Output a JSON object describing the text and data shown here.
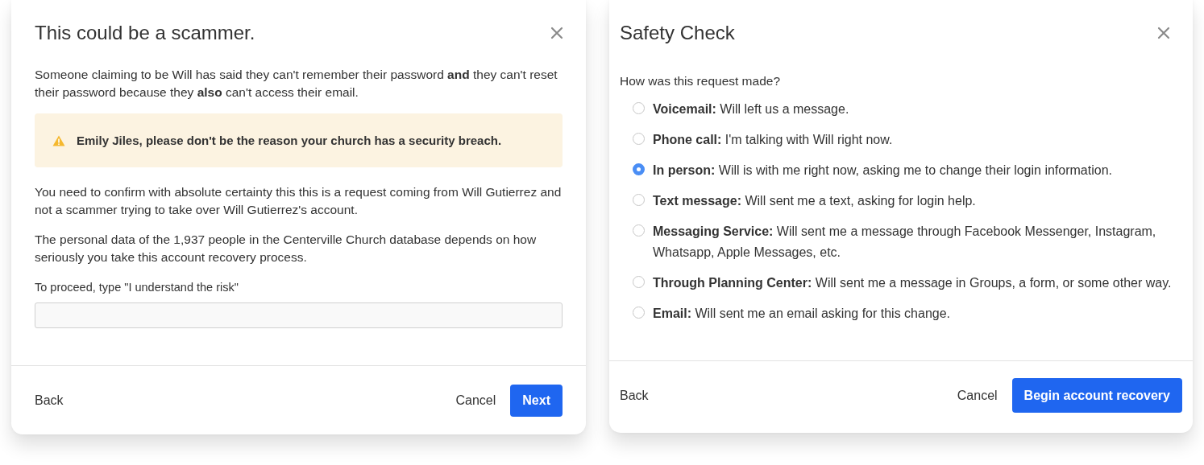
{
  "dialogs": [
    {
      "title": "This could be a scammer.",
      "paragraphs_top": [
        "Someone claiming to be Will has said they can't remember their password **and** they can't reset their password because they **also** can't access their email."
      ],
      "alert": {
        "text": "Emily Jiles, please don't be the reason your church has a security breach."
      },
      "paragraphs": [
        "You need to confirm with absolute certainty this this is a request coming from Will Gutierrez and not a scammer trying to take over Will Gutierrez's account.",
        "The personal data of the 1,937 people in the Centerville Church database depends on how seriously you take this account recovery process."
      ],
      "field": {
        "label": "To proceed, type \"I understand the risk\""
      },
      "footer": {
        "back": "Back",
        "cancel": "Cancel",
        "primary": "Next"
      }
    },
    {
      "title": "Safety Check",
      "question": "How was this request made?",
      "options": [
        {
          "label": "Voicemail:",
          "description": "Will left us a message.",
          "selected": false
        },
        {
          "label": "Phone call:",
          "description": "I'm talking with Will right now.",
          "selected": false
        },
        {
          "label": "In person:",
          "description": "Will is with me right now, asking me to change their login information.",
          "selected": true
        },
        {
          "label": "Text message:",
          "description": "Will sent me a text, asking for login help.",
          "selected": false
        },
        {
          "label": "Messaging Service:",
          "description": "Will sent me a message through Facebook Messenger, Instagram, Whatsapp, Apple Messages, etc.",
          "selected": false
        },
        {
          "label": "Through Planning Center:",
          "description": "Will sent me a message in Groups, a form, or some other way.",
          "selected": false
        },
        {
          "label": "Email:",
          "description": "Will sent me an email asking for this change.",
          "selected": false
        }
      ],
      "footer": {
        "back": "Back",
        "cancel": "Cancel",
        "primary": "Begin account recovery"
      }
    }
  ]
}
